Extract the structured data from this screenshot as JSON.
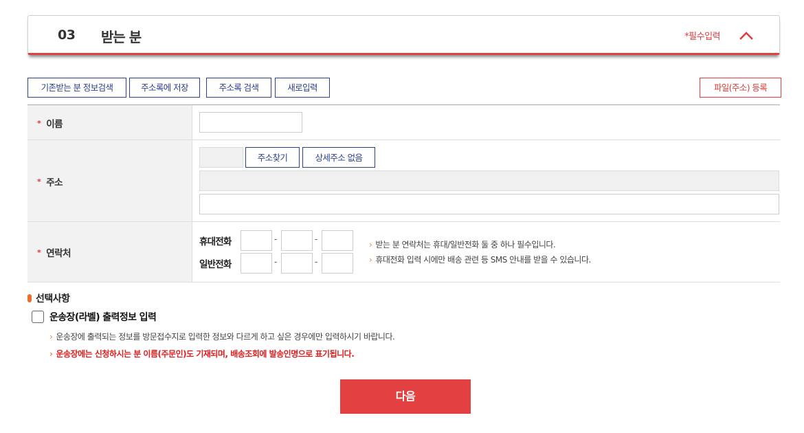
{
  "section": {
    "number": "03",
    "title": "받는 분",
    "required_note": "*필수입력",
    "collapse_icon": "chevron-up-icon"
  },
  "toolbar": {
    "search_previous": "기존받는 분 정보검색",
    "save_to_book": "주소록에 저장",
    "search_book": "주소록 검색",
    "new_input": "새로입력",
    "file_register": "파일(주소) 등록"
  },
  "form": {
    "name_label": "이름",
    "address_label": "주소",
    "contact_label": "연락처",
    "required_star": "*",
    "find_address": "주소찾기",
    "no_detail_address": "상세주소 없음",
    "mobile_label": "휴대전화",
    "phone_label": "일반전화",
    "dash": "-",
    "notes": [
      "받는 분 연락처는 휴대/일반전화 둘 중 하나 필수입니다.",
      "휴대전화 입력 시에만 배송 관련 등 SMS 안내를 받을 수 있습니다."
    ]
  },
  "optional": {
    "title": "선택사항",
    "checkbox_label": "운송장(라벨) 출력정보 입력",
    "checked": false,
    "note": "운송장에 출력되는 정보를 방문접수지로 입력한 정보와 다르게 하고 싶은 경우에만 입력하시기 바랍니다.",
    "warning": "운송장에는 신청하시는 분 이름(주문인)도 기재되며, 배송조회에 발송인명으로 표기됩니다."
  },
  "next_button": "다음",
  "colors": {
    "accent_red": "#e04040",
    "navy": "#2b3f8a",
    "orange": "#e8702a"
  }
}
